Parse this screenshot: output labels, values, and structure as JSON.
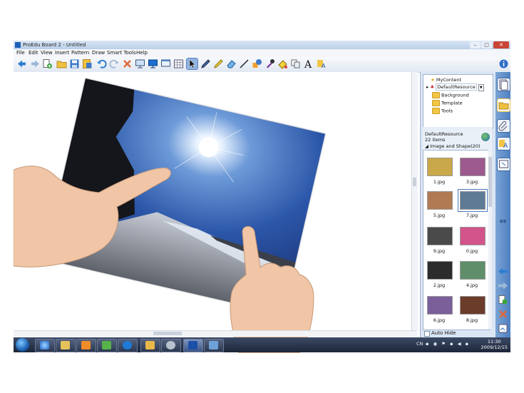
{
  "window": {
    "title": "ProEdu Board 2 - Untitled"
  },
  "menu": [
    "File",
    "Edit",
    "View",
    "Insert",
    "Pattern",
    "Draw",
    "Smart Tools",
    "Help"
  ],
  "toolbar": {
    "buttons": [
      "back",
      "forward",
      "add",
      "open",
      "save",
      "save-as",
      "undo",
      "redo",
      "delete",
      "screen",
      "display",
      "window",
      "table",
      "select",
      "pen",
      "highlighter",
      "eraser",
      "line",
      "shape",
      "fill",
      "magic",
      "copy",
      "text",
      "font"
    ],
    "active": "select"
  },
  "resources": {
    "tree": [
      {
        "label": "MyContent",
        "icon": "star-folder-icon"
      },
      {
        "label": "DefaultResource",
        "icon": "resource-icon",
        "selected": true
      },
      {
        "label": "Background",
        "icon": "folder-icon"
      },
      {
        "label": "Template",
        "icon": "folder-icon"
      },
      {
        "label": "Tools",
        "icon": "folder-icon"
      }
    ],
    "header": {
      "title": "DefaultResource",
      "count": "22 items",
      "category": "Image and Shape(20)"
    },
    "items": [
      {
        "label": "1.jpg",
        "color": "#c9a84a"
      },
      {
        "label": "3.jpg",
        "color": "#9c5a8e"
      },
      {
        "label": "5.jpg",
        "color": "#b17a52"
      },
      {
        "label": "7.jpg",
        "color": "#5f7a94",
        "selected": true
      },
      {
        "label": "9.jpg",
        "color": "#4a4a4a"
      },
      {
        "label": "0.jpg",
        "color": "#d2548a"
      },
      {
        "label": "2.jpg",
        "color": "#2c2c2c"
      },
      {
        "label": "4.jpg",
        "color": "#5f8f6a"
      },
      {
        "label": "6.jpg",
        "color": "#7b5f9a"
      },
      {
        "label": "8.jpg",
        "color": "#6b3c2a"
      }
    ],
    "auto_hide": "Auto Hide"
  },
  "taskbar": {
    "language": "CN",
    "time": "11:30",
    "date": "2009/12/15"
  }
}
